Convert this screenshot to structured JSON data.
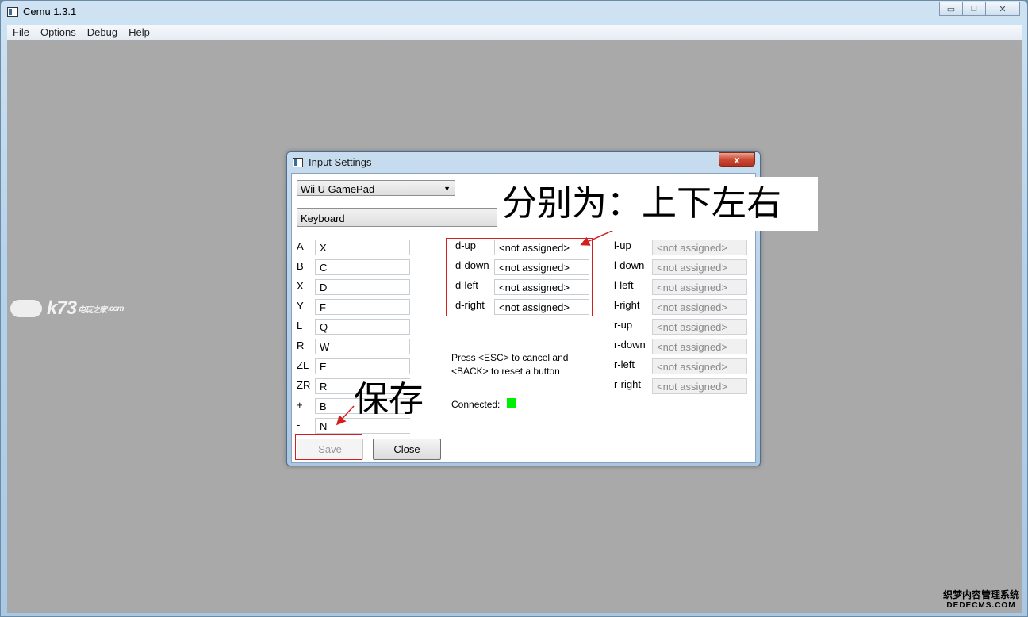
{
  "app": {
    "title": "Cemu 1.3.1",
    "menu": [
      "File",
      "Options",
      "Debug",
      "Help"
    ],
    "window_controls": {
      "minimize": "▭",
      "maximize": "□",
      "close": "✕"
    }
  },
  "dialog": {
    "title": "Input Settings",
    "close_glyph": "x",
    "controller_type": "Wii U GamePad",
    "api": "Keyboard",
    "buttons_left": [
      {
        "label": "A",
        "value": "X"
      },
      {
        "label": "B",
        "value": "C"
      },
      {
        "label": "X",
        "value": "D"
      },
      {
        "label": "Y",
        "value": "F"
      },
      {
        "label": "L",
        "value": "Q"
      },
      {
        "label": "R",
        "value": "W"
      },
      {
        "label": "ZL",
        "value": "E"
      },
      {
        "label": "ZR",
        "value": "R"
      },
      {
        "label": "+",
        "value": "B"
      },
      {
        "label": "-",
        "value": "N"
      }
    ],
    "dpad": [
      {
        "label": "d-up",
        "value": "<not assigned>"
      },
      {
        "label": "d-down",
        "value": "<not assigned>"
      },
      {
        "label": "d-left",
        "value": "<not assigned>"
      },
      {
        "label": "d-right",
        "value": "<not assigned>"
      }
    ],
    "sticks": [
      {
        "label": "l-up",
        "value": "<not assigned>"
      },
      {
        "label": "l-down",
        "value": "<not assigned>"
      },
      {
        "label": "l-left",
        "value": "<not assigned>"
      },
      {
        "label": "l-right",
        "value": "<not assigned>"
      },
      {
        "label": "r-up",
        "value": "<not assigned>"
      },
      {
        "label": "r-down",
        "value": "<not assigned>"
      },
      {
        "label": "r-left",
        "value": "<not assigned>"
      },
      {
        "label": "r-right",
        "value": "<not assigned>"
      }
    ],
    "info_line1": "Press <ESC> to cancel and",
    "info_line2": "<BACK> to reset a button",
    "connected_label": "Connected:",
    "save_label": "Save",
    "close_label": "Close"
  },
  "annotations": {
    "dpad_note": "分别为：上下左右",
    "save_note": "保存",
    "annotation_color": "#d21f1f"
  },
  "watermarks": {
    "logo_text": "k73",
    "logo_sub": "电玩之家",
    "logo_domain": ".com",
    "corner_line1": "织梦内容管理系统",
    "corner_line2": "DEDECMS.COM"
  },
  "colors": {
    "connected_indicator": "#00ee00",
    "dialog_close": "#cc4a35"
  }
}
